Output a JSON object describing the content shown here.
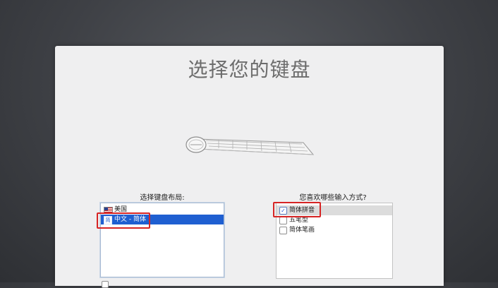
{
  "page": {
    "title": "选择您的键盘"
  },
  "layout_column": {
    "label": "选择键盘布局:",
    "items": [
      {
        "label": "美国",
        "icon": "us-flag-icon",
        "selected": false
      },
      {
        "label": "中文 - 简体",
        "icon": "chinese-input-icon",
        "icon_glyph": "简",
        "selected": true
      }
    ]
  },
  "input_column": {
    "label": "您喜欢哪些输入方式?",
    "items": [
      {
        "label": "简体拼音",
        "checked": true
      },
      {
        "label": "五笔型",
        "checked": false
      },
      {
        "label": "简体笔画",
        "checked": false
      }
    ]
  },
  "colors": {
    "selection": "#1f5fd1",
    "highlight_box": "#d62424",
    "panel_bg": "#efeff0",
    "desktop_bg": "#3e4045"
  }
}
